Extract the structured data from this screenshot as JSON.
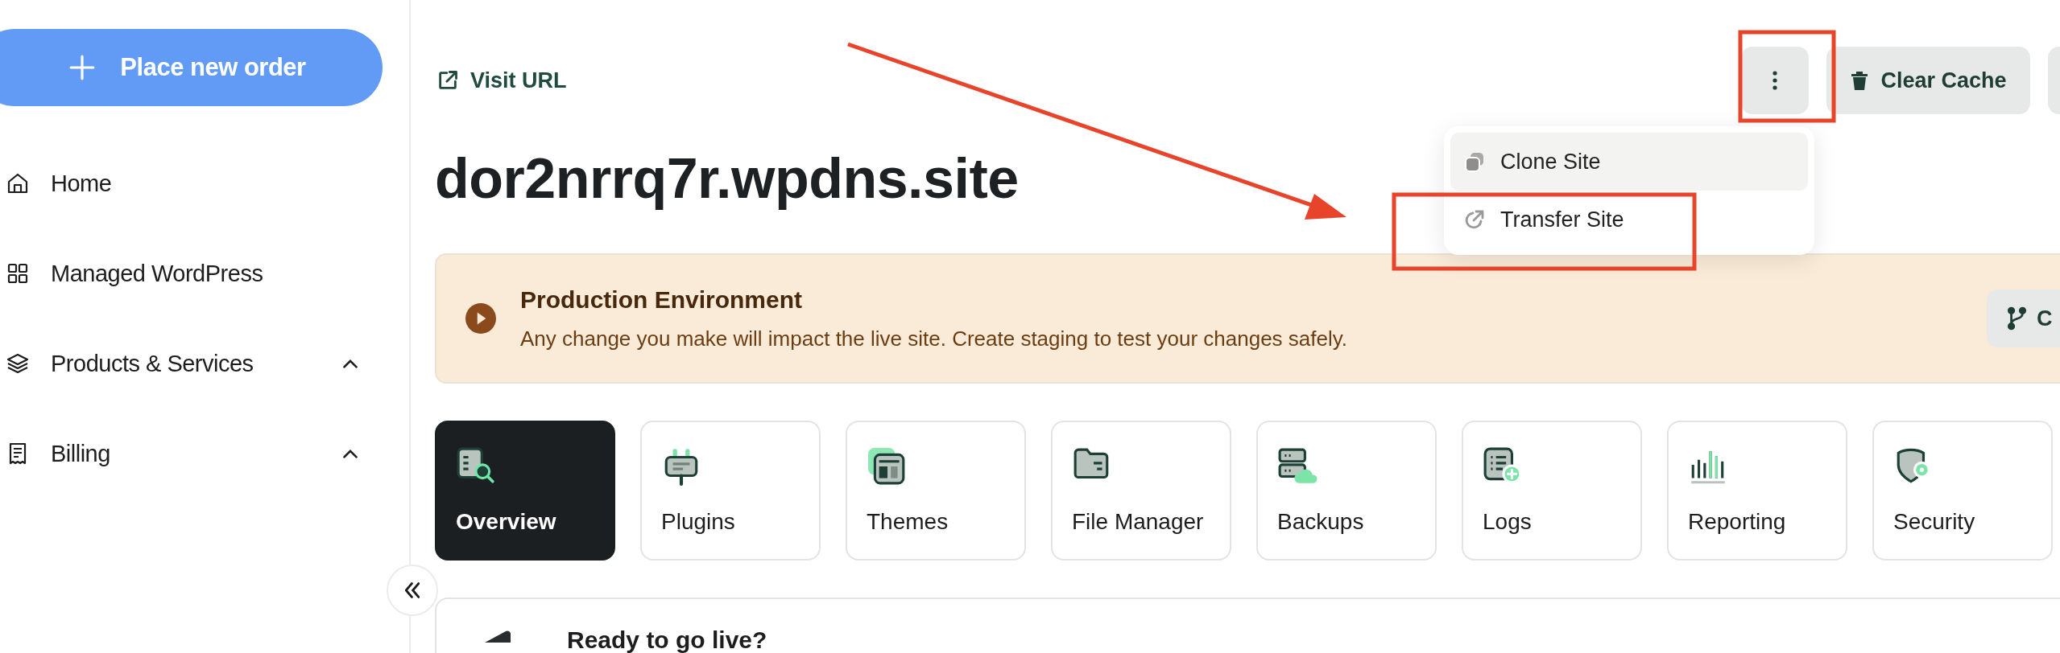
{
  "sidebar": {
    "order_button": "Place new order",
    "items": [
      {
        "label": "Home",
        "kind": "link"
      },
      {
        "label": "Managed WordPress",
        "kind": "link"
      },
      {
        "label": "Products & Services",
        "kind": "group",
        "expanded": true
      },
      {
        "label": "Billing",
        "kind": "group",
        "expanded": true
      }
    ]
  },
  "header": {
    "visit_link": "Visit URL",
    "site_title": "dor2nrrq7r.wpdns.site",
    "clear_cache": "Clear Cache"
  },
  "menu": {
    "items": [
      {
        "label": "Clone Site",
        "selected": true
      },
      {
        "label": "Transfer Site",
        "selected": false
      }
    ]
  },
  "banner": {
    "title": "Production Environment",
    "text": "Any change you make will impact the live site. Create staging to test your changes safely.",
    "button": "C"
  },
  "tabs": [
    {
      "label": "Overview",
      "selected": true
    },
    {
      "label": "Plugins",
      "selected": false
    },
    {
      "label": "Themes",
      "selected": false
    },
    {
      "label": "File Manager",
      "selected": false
    },
    {
      "label": "Backups",
      "selected": false
    },
    {
      "label": "Logs",
      "selected": false
    },
    {
      "label": "Reporting",
      "selected": false
    },
    {
      "label": "Security",
      "selected": false
    }
  ],
  "ready_card": {
    "title": "Ready to go live?"
  }
}
